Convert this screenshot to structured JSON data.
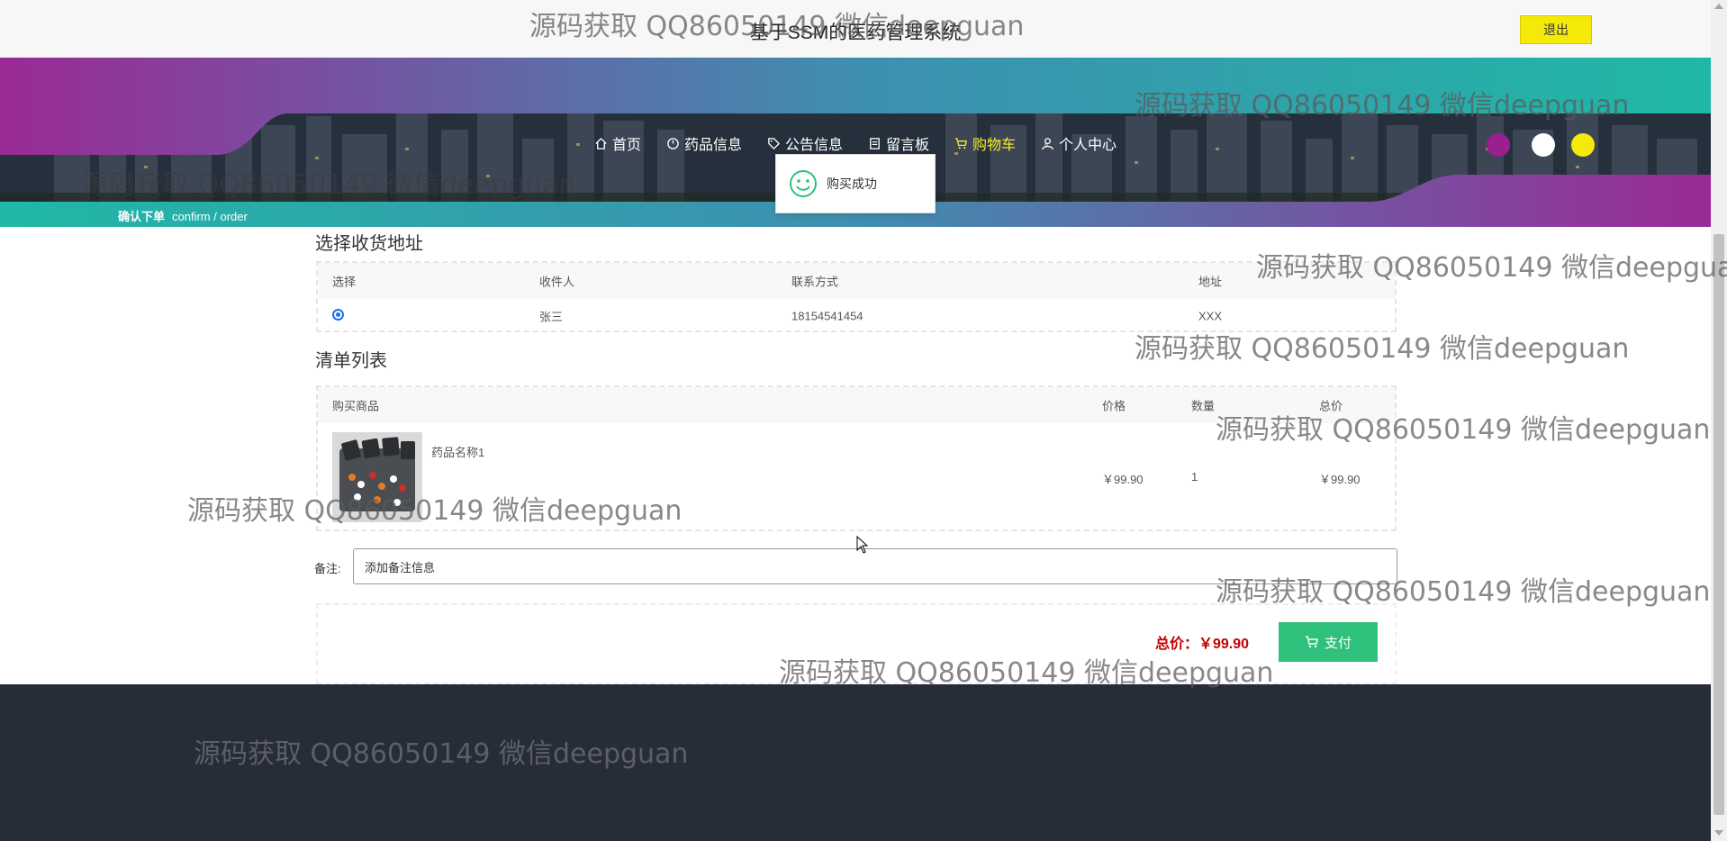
{
  "header": {
    "title": "基于SSM的医药管理系统",
    "logout_label": "退出"
  },
  "nav": {
    "items": [
      {
        "label": "首页",
        "icon": "home-icon"
      },
      {
        "label": "药品信息",
        "icon": "clock-icon"
      },
      {
        "label": "公告信息",
        "icon": "tag-icon"
      },
      {
        "label": "留言板",
        "icon": "clipboard-icon"
      },
      {
        "label": "购物车",
        "icon": "cart-icon",
        "active": true
      },
      {
        "label": "个人中心",
        "icon": "user-icon"
      }
    ],
    "theme_colors": [
      "#9c1f8e",
      "#ffffff",
      "#f5e90a"
    ],
    "active_color": "#f7ef2a"
  },
  "breadcrumb": {
    "cn": "确认下单",
    "en": "confirm / order"
  },
  "toast": {
    "message": "购买成功",
    "icon": "smile-icon"
  },
  "address_section": {
    "title": "选择收货地址",
    "headers": [
      "选择",
      "收件人",
      "联系方式",
      "地址"
    ],
    "rows": [
      {
        "selected": true,
        "recipient": "张三",
        "phone": "18154541454",
        "address": "XXX"
      }
    ]
  },
  "order_section": {
    "title": "清单列表",
    "headers": [
      "购买商品",
      "价格",
      "数量",
      "总价"
    ],
    "items": [
      {
        "name": "药品名称1",
        "price": "￥99.90",
        "quantity": "1",
        "total": "￥99.90"
      }
    ]
  },
  "remark": {
    "label": "备注:",
    "value": "添加备注信息"
  },
  "summary": {
    "total_label": "总价：￥99.90",
    "pay_label": "支付",
    "pay_color": "#2fc07b"
  },
  "watermark": {
    "text": "源码获取 QQ86050149 微信deepguan"
  }
}
